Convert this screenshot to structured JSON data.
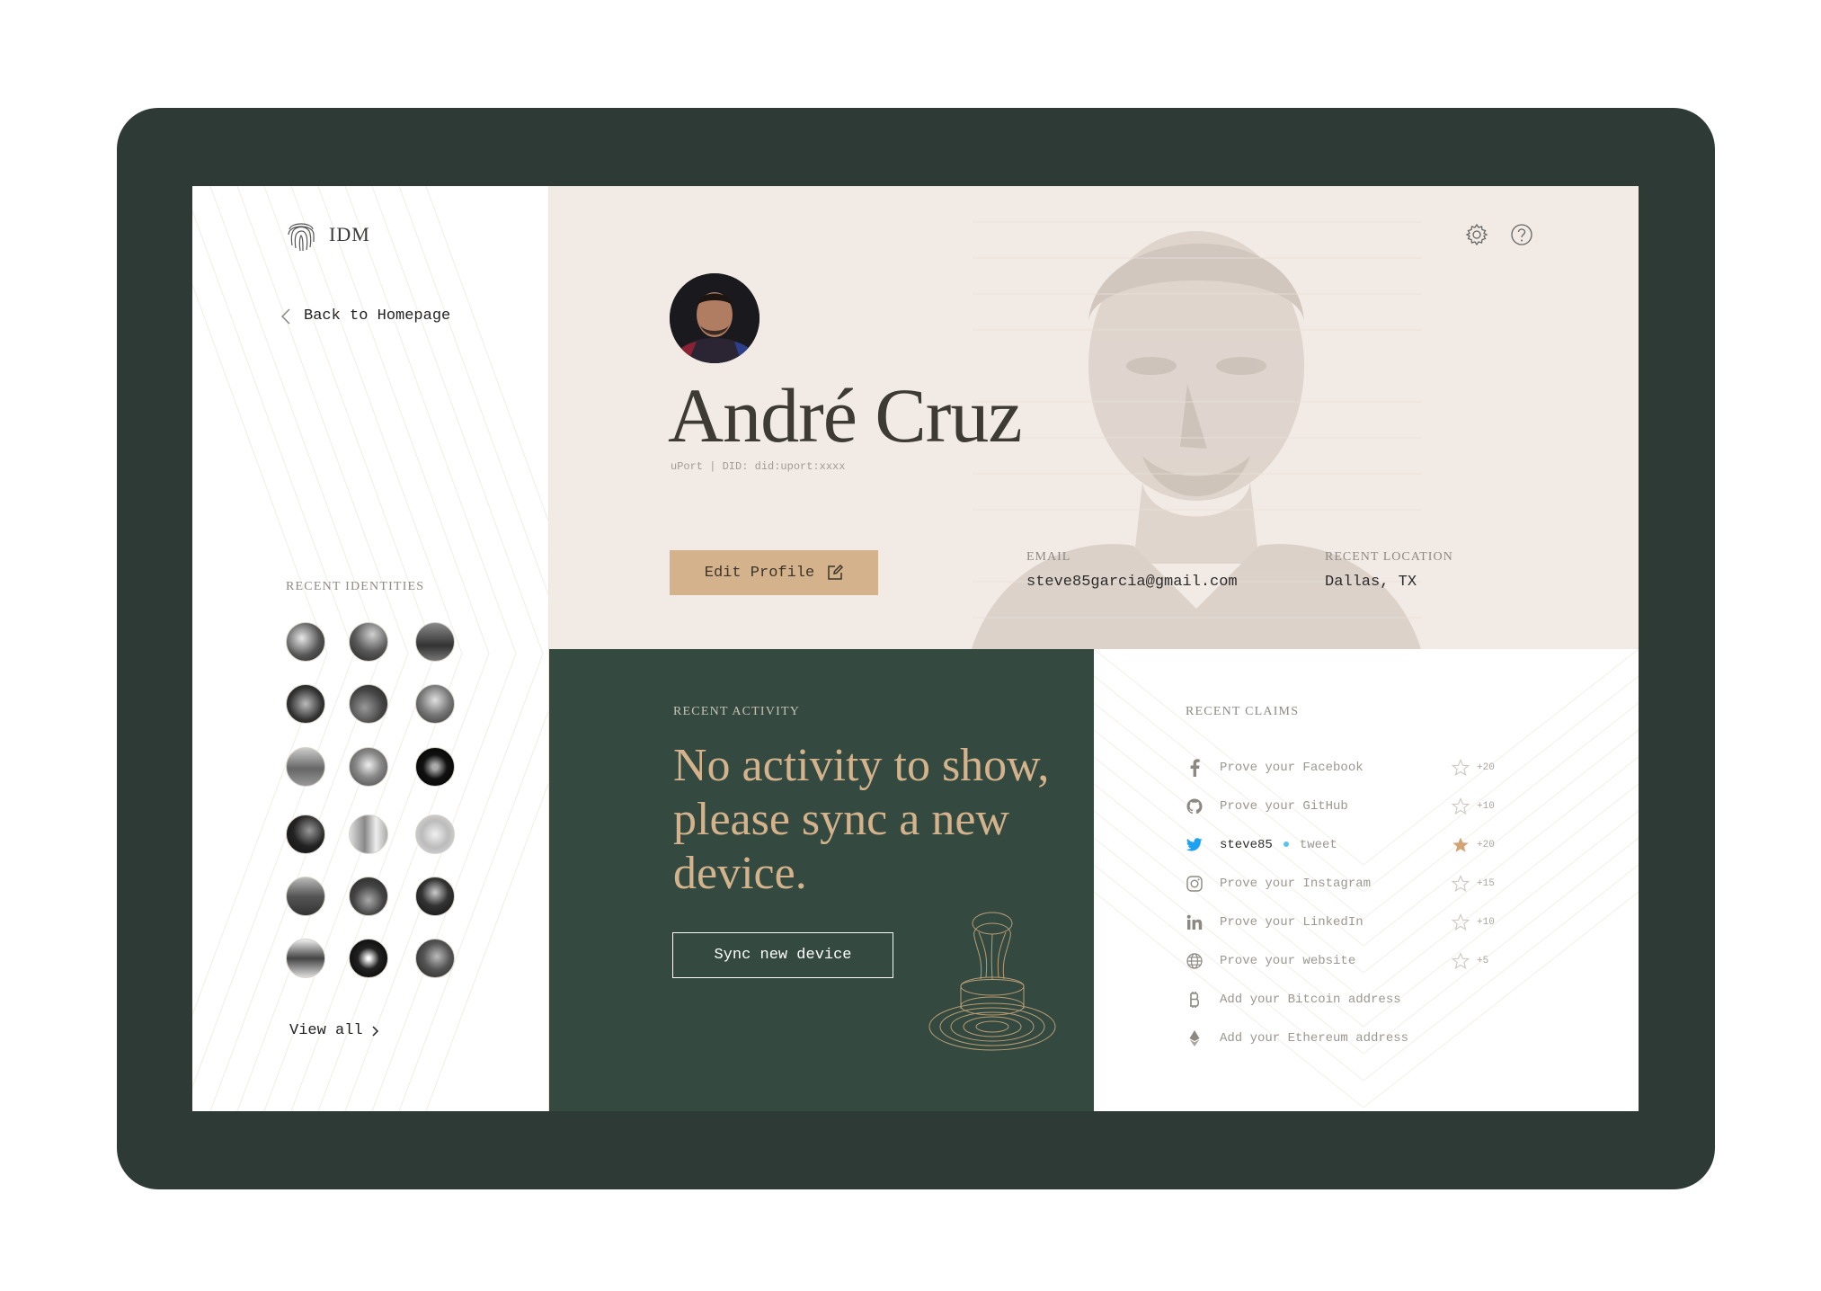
{
  "app": {
    "logo_text": "IDM"
  },
  "sidebar": {
    "back_label": "Back to Homepage",
    "recent_label": "RECENT IDENTITIES",
    "view_all_label": "View all",
    "identity_count": 18
  },
  "profile": {
    "name": "André Cruz",
    "did": "uPort | DID: did:uport:xxxx",
    "edit_label": "Edit Profile",
    "email_label": "EMAIL",
    "email": "steve85garcia@gmail.com",
    "location_label": "RECENT LOCATION",
    "location": "Dallas, TX"
  },
  "activity": {
    "label": "RECENT ACTIVITY",
    "message": "No activity to show, please sync a new device.",
    "sync_label": "Sync new device"
  },
  "claims": {
    "label": "RECENT CLAIMS",
    "items": [
      {
        "icon": "facebook-icon",
        "text": "Prove your Facebook",
        "points": "+20",
        "starred": false
      },
      {
        "icon": "github-icon",
        "text": "Prove your GitHub",
        "points": "+10",
        "starred": false
      },
      {
        "icon": "twitter-icon",
        "text": "steve85",
        "sub": "tweet",
        "points": "+20",
        "starred": true
      },
      {
        "icon": "instagram-icon",
        "text": "Prove your Instagram",
        "points": "+15",
        "starred": false
      },
      {
        "icon": "linkedin-icon",
        "text": "Prove your LinkedIn",
        "points": "+10",
        "starred": false
      },
      {
        "icon": "globe-icon",
        "text": "Prove your website",
        "points": "+5",
        "starred": false
      },
      {
        "icon": "bitcoin-icon",
        "text": "Add your Bitcoin address"
      },
      {
        "icon": "ethereum-icon",
        "text": "Add your Ethereum address"
      }
    ]
  },
  "colors": {
    "frame": "#2e3a35",
    "hero_bg": "#f2eae4",
    "accent_tan": "#d4b38c",
    "activity_bg": "#344a40",
    "twitter_blue": "#1da1f2",
    "star_active": "#d4a373"
  }
}
